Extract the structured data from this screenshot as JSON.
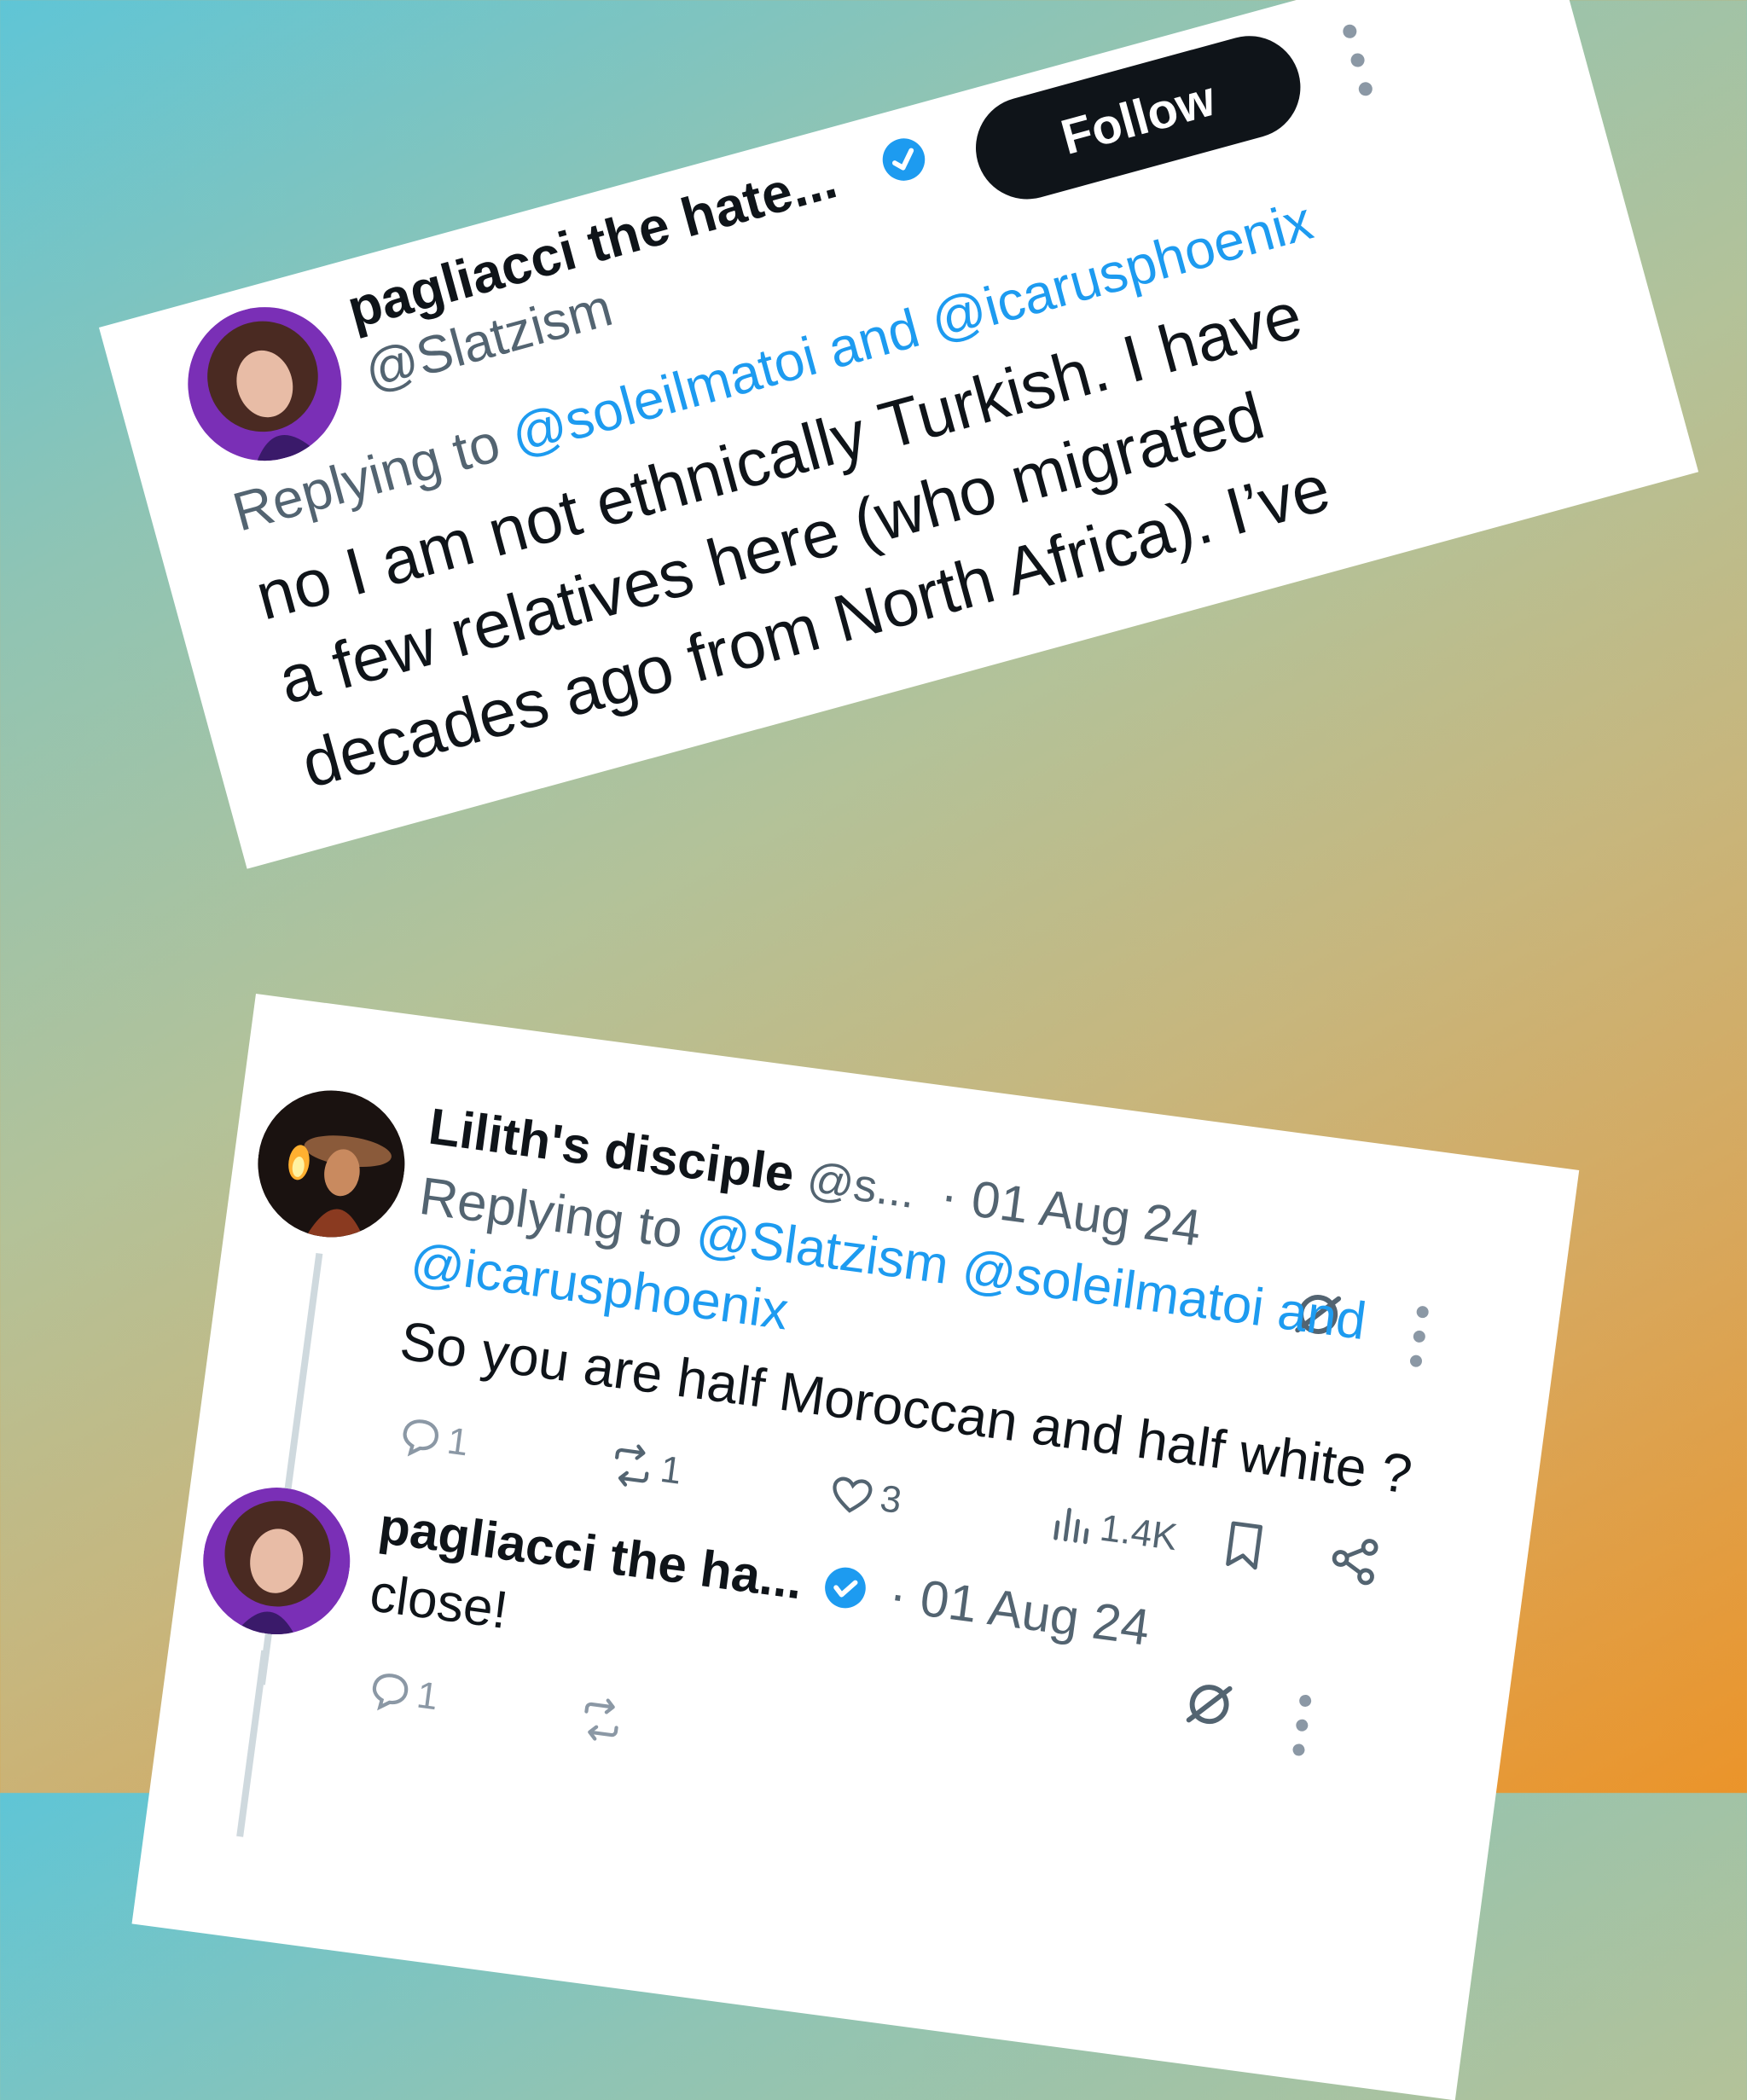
{
  "colors": {
    "link": "#1d9bf0",
    "text": "#0f1419",
    "muted": "#536471",
    "verified": "#1d9bf0",
    "follow_bg": "#0f1419",
    "follow_text": "#ffffff"
  },
  "tweet_top": {
    "avatar_icon": "profile-photo-woman-curly-hair",
    "display_name": "pagliacci the hate...",
    "verified_icon": "verified-badge-icon",
    "handle": "@Slatzism",
    "follow_label": "Follow",
    "more_icon": "more-vertical-icon",
    "reply_prefix": "Replying to",
    "reply_mentions": "@soleilmatoi and @icarusphoenix",
    "text_lines": [
      "no I am not ethnically Turkish. I have",
      "a few relatives here (who migrated",
      "decades ago from North Africa). I’ve"
    ]
  },
  "tweet_reply": {
    "avatar_icon": "profile-photo-witch-holding-flame",
    "display_name": "Lilith's disciple",
    "handle": "@s...",
    "date": "· 01 Aug 24",
    "grok_icon": "grok-slash-icon",
    "more_icon": "more-vertical-icon",
    "reply_prefix": "Replying to",
    "reply_mentions_line1": "@Slatzism @soleilmatoi and",
    "reply_mentions_line2": "@icarusphoenix",
    "text": "So you are half Moroccan and half white ?",
    "actions": {
      "replies": "1",
      "reposts": "1",
      "likes": "3",
      "views": "1.4K",
      "reply_icon": "reply-bubble-icon",
      "repost_icon": "repost-icon",
      "like_icon": "heart-icon",
      "views_icon": "views-bar-chart-icon",
      "bookmark_icon": "bookmark-icon",
      "share_icon": "share-icon"
    }
  },
  "tweet_bottom": {
    "avatar_icon": "profile-photo-woman-curly-hair",
    "display_name": "pagliacci the ha...",
    "verified_icon": "verified-badge-icon",
    "date": "· 01 Aug 24",
    "grok_icon": "grok-slash-icon",
    "more_icon": "more-vertical-icon",
    "text": "close!",
    "actions": {
      "replies": "1"
    }
  }
}
